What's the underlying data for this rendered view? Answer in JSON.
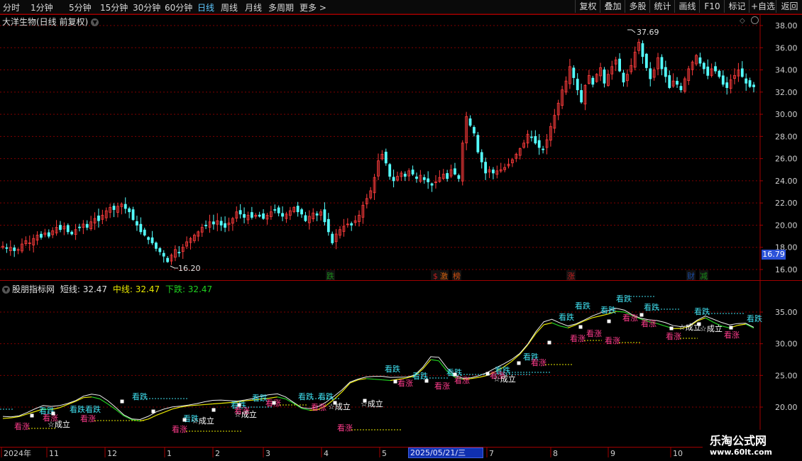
{
  "toolbar": {
    "periods": [
      "分时",
      "1分钟",
      "5分钟",
      "15分钟",
      "30分钟",
      "60分钟",
      "日线",
      "周线",
      "月线",
      "多周期",
      "更多 >"
    ],
    "active_period": "日线",
    "buttons": [
      "复权",
      "叠加",
      "多股",
      "统计",
      "画线",
      "F10",
      "标记",
      "+自选",
      "返回"
    ]
  },
  "stock": {
    "title": "大洋生物(日线 前复权)"
  },
  "price_axis": {
    "ticks": [
      "38.00",
      "36.00",
      "34.00",
      "32.00",
      "30.00",
      "28.00",
      "26.00",
      "24.00",
      "22.00",
      "20.00",
      "18.00",
      "16.00"
    ],
    "current_price": "16.79"
  },
  "annotations": {
    "high_label": "37.69",
    "low_label": "16.20"
  },
  "event_markers": [
    {
      "text": "跌",
      "color": "#1a8a1a"
    },
    {
      "text": "$",
      "color": "#c02020"
    },
    {
      "text": "激",
      "color": "#d06010"
    },
    {
      "text": "榜",
      "color": "#d05010"
    },
    {
      "text": "涨",
      "color": "#c02020"
    },
    {
      "text": "财",
      "color": "#1a4aa0"
    },
    {
      "text": "减",
      "color": "#1a8a1a"
    }
  ],
  "indicator": {
    "name": "股朋指标网",
    "values": [
      {
        "label": "短线: 32.47",
        "color": "#e0e0e0"
      },
      {
        "label": "中线: 32.47",
        "color": "#e8e800"
      },
      {
        "label": "下跌: 32.47",
        "color": "#20d020"
      }
    ],
    "axis_ticks": [
      "35.00",
      "30.00",
      "25.00",
      "20.00"
    ],
    "signal_texts": {
      "bear": "看跌",
      "bull": "看涨",
      "confirm": "☆成立"
    }
  },
  "date_axis": {
    "labels": [
      "2024年",
      "11",
      "12",
      "1",
      "2",
      "3",
      "4",
      "5",
      "2025/05/21/三",
      "7",
      "8",
      "9",
      "10"
    ],
    "highlighted": "2025/05/21/三"
  },
  "watermark": {
    "line1": "乐淘公式网",
    "line2": "www.60lt.com"
  },
  "colors": {
    "up": "#ff3c3c",
    "down": "#54ffff",
    "grid": "#800000",
    "frame": "#a00000",
    "bull_signal": "#ff3c8c",
    "bear_signal": "#40e0f0"
  },
  "chart_data": [
    {
      "type": "candlestick",
      "title": "大洋生物(日线 前复权)",
      "ylim": [
        16.0,
        38.0
      ],
      "high": 37.69,
      "low": 16.2,
      "last": 32.47,
      "closes": [
        18.1,
        17.9,
        18.0,
        17.7,
        17.8,
        18.3,
        18.6,
        18.4,
        18.8,
        19.1,
        18.9,
        19.3,
        19.0,
        19.5,
        19.8,
        19.6,
        19.9,
        19.4,
        19.2,
        19.6,
        19.8,
        20.1,
        19.8,
        20.3,
        20.6,
        20.4,
        20.9,
        21.3,
        21.6,
        21.4,
        21.7,
        21.9,
        21.5,
        21.2,
        20.5,
        20.0,
        19.4,
        19.1,
        18.7,
        18.4,
        17.9,
        17.6,
        17.2,
        16.7,
        17.3,
        17.8,
        17.5,
        18.0,
        18.5,
        18.8,
        19.1,
        19.4,
        19.8,
        20.0,
        20.3,
        20.1,
        20.4,
        20.0,
        19.8,
        20.2,
        20.6,
        21.2,
        21.0,
        20.7,
        20.9,
        20.7,
        20.9,
        20.8,
        20.6,
        20.9,
        21.2,
        21.4,
        21.1,
        20.8,
        21.0,
        21.3,
        21.6,
        21.2,
        21.0,
        20.4,
        20.8,
        21.1,
        20.9,
        21.2,
        20.3,
        19.4,
        18.4,
        19.2,
        19.6,
        19.9,
        20.1,
        20.0,
        20.4,
        20.9,
        21.8,
        22.4,
        23.1,
        24.3,
        25.8,
        26.4,
        25.6,
        24.4,
        24.0,
        24.4,
        24.7,
        24.4,
        24.9,
        24.6,
        24.2,
        24.5,
        24.1,
        23.9,
        23.6,
        23.9,
        24.3,
        24.6,
        24.2,
        25.0,
        24.6,
        24.2,
        27.4,
        29.8,
        29.0,
        28.3,
        26.6,
        25.7,
        24.7,
        25.0,
        24.7,
        24.9,
        25.0,
        25.2,
        25.5,
        25.9,
        26.4,
        26.9,
        27.4,
        28.2,
        27.9,
        27.4,
        27.0,
        26.8,
        27.7,
        28.9,
        29.9,
        31.0,
        32.2,
        33.0,
        34.3,
        33.3,
        32.2,
        31.1,
        32.6,
        33.5,
        32.7,
        33.6,
        34.2,
        32.8,
        33.6,
        34.3,
        34.9,
        33.9,
        32.9,
        33.6,
        34.4,
        35.6,
        36.5,
        35.2,
        34.2,
        33.2,
        34.0,
        35.1,
        34.1,
        33.4,
        32.4,
        33.0,
        32.7,
        32.2,
        33.2,
        34.1,
        34.7,
        35.3,
        34.6,
        34.1,
        33.5,
        34.1,
        33.9,
        33.4,
        32.7,
        32.4,
        33.1,
        33.5,
        34.0,
        33.4,
        32.8,
        32.5,
        32.47
      ]
    },
    {
      "type": "line",
      "title": "股朋指标网",
      "ylim": [
        17.0,
        40.0
      ],
      "series": [
        {
          "name": "短线",
          "values": [
            18.2,
            18.3,
            18.5,
            18.9,
            19.3,
            19.7,
            19.6,
            19.9,
            20.4,
            20.9,
            21.5,
            21.6,
            21.3,
            20.5,
            19.6,
            18.6,
            18.0,
            17.8,
            18.1,
            18.7,
            19.2,
            19.7,
            20.0,
            20.2,
            20.3,
            20.4,
            20.5,
            20.6,
            20.7,
            20.8,
            21.0,
            21.1,
            21.3,
            21.4,
            21.6,
            21.3,
            20.6,
            19.8,
            19.5,
            19.6,
            20.2,
            21.2,
            22.4,
            23.8,
            24.3,
            24.5,
            24.4,
            24.3,
            24.2,
            24.4,
            24.6,
            24.9,
            26.0,
            27.5,
            27.3,
            25.7,
            24.7,
            24.4,
            24.5,
            24.7,
            25.0,
            25.6,
            26.3,
            27.2,
            28.3,
            29.8,
            31.6,
            33.0,
            33.3,
            32.8,
            32.5,
            33.0,
            33.6,
            34.1,
            34.4,
            34.7,
            35.1,
            35.0,
            34.4,
            33.9,
            33.5,
            33.2,
            32.8,
            32.4,
            32.4,
            32.7,
            33.6,
            34.1,
            33.4,
            32.8,
            32.5,
            32.9,
            33.1,
            32.47
          ]
        }
      ]
    }
  ]
}
